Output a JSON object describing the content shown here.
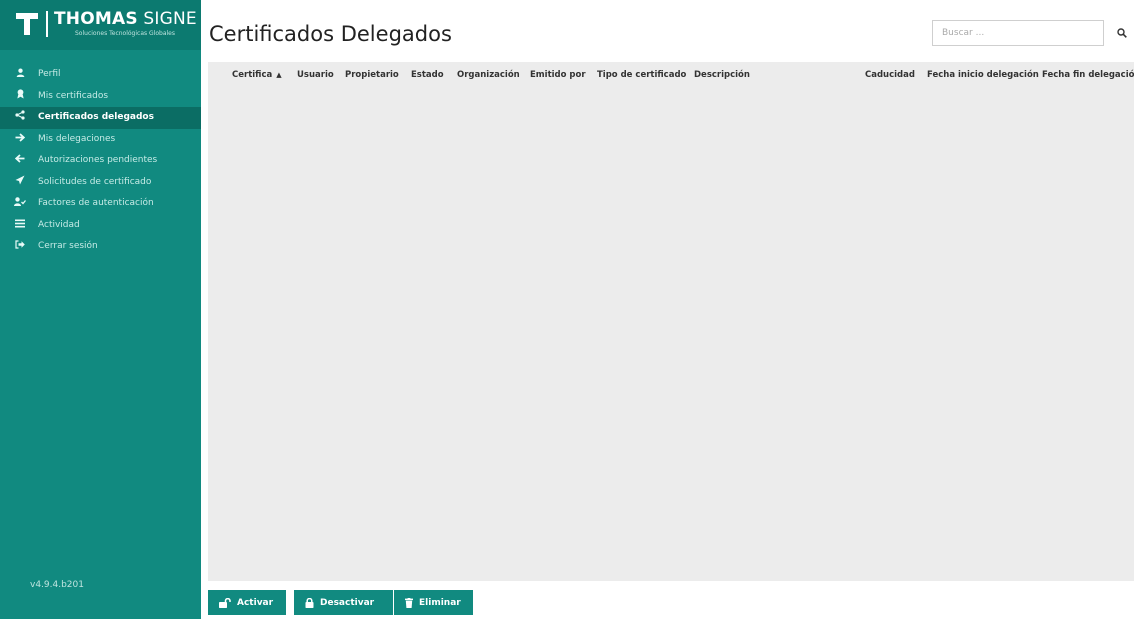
{
  "brand": {
    "name_bold": "THOMAS",
    "name_light": " SIGNE",
    "tagline": "Soluciones Tecnológicas Globales"
  },
  "sidebar": {
    "items": [
      {
        "label": "Perfil",
        "icon": "user-icon",
        "glyph": "👤"
      },
      {
        "label": "Mis certificados",
        "icon": "certificate-icon",
        "glyph": "☗"
      },
      {
        "label": "Certificados delegados",
        "icon": "share-icon",
        "glyph": "<"
      },
      {
        "label": "Mis delegaciones",
        "icon": "arrow-right-icon",
        "glyph": "→"
      },
      {
        "label": "Autorizaciones pendientes",
        "icon": "arrow-left-icon",
        "glyph": "←"
      },
      {
        "label": "Solicitudes de certificado",
        "icon": "send-icon",
        "glyph": "➤"
      },
      {
        "label": "Factores de autenticación",
        "icon": "user-check-icon",
        "glyph": "✔"
      },
      {
        "label": "Actividad",
        "icon": "list-icon",
        "glyph": "☰"
      },
      {
        "label": "Cerrar sesión",
        "icon": "sign-out-icon",
        "glyph": "⇥"
      }
    ],
    "active_index": 2,
    "version": "v4.9.4.b201"
  },
  "page": {
    "title": "Certificados Delegados"
  },
  "search": {
    "placeholder": "Buscar ...",
    "value": ""
  },
  "table": {
    "columns": [
      "Certifica",
      "Usuario",
      "Propietario",
      "Estado",
      "Organización",
      "Emitido por",
      "Tipo de certificado",
      "Descripción",
      "Caducidad",
      "Fecha inicio delegación",
      "Fecha fin delegación"
    ],
    "sort_caret": "▲",
    "rows": []
  },
  "actions": {
    "activate": "Activar",
    "deactivate": "Desactivar",
    "delete": "Eliminar"
  },
  "colors": {
    "sidebar_bg": "#118a80",
    "sidebar_active": "#0b6d64",
    "button_bg": "#118a80",
    "table_bg": "#ececec"
  }
}
